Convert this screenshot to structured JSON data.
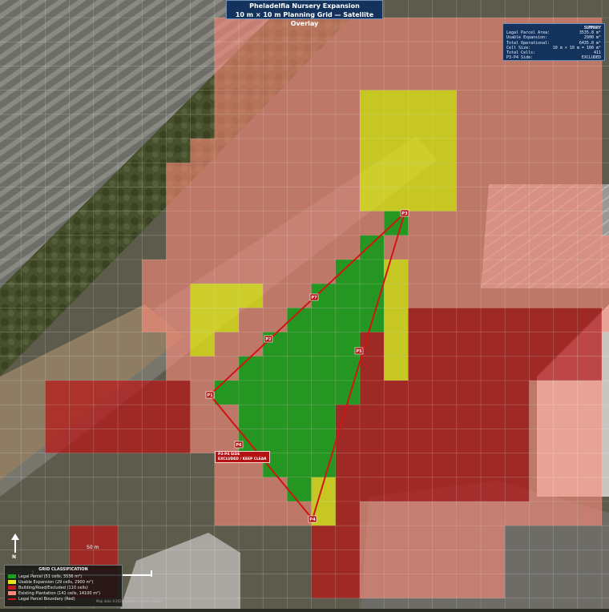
{
  "title": {
    "line1": "Pheladelfia Nursery Expansion",
    "line2": "10 m × 10 m Planning Grid — Satellite Overlay"
  },
  "summary": {
    "heading": "SUMMARY",
    "rows": [
      {
        "label": "Legal Parcel Area:",
        "value": "3535.8 m²"
      },
      {
        "label": "Usable Expansion:",
        "value": "2900 m²"
      },
      {
        "label": "Total Operational:",
        "value": "6435.8 m²"
      },
      {
        "label": "Cell Size:",
        "value": "10 m × 10 m = 100 m²"
      },
      {
        "label": "Total Cells:",
        "value": "411"
      },
      {
        "label": "P3-P4 Side:",
        "value": "EXCLUDED"
      }
    ]
  },
  "legend": {
    "heading": "GRID CLASSIFICATION",
    "items": [
      {
        "label": "Legal Parcel (51 cells, 3536 m²)",
        "color": "#1aa31a",
        "kind": "box"
      },
      {
        "label": "Usable Expansion (29 cells, 2900 m²)",
        "color": "#e5e51a",
        "kind": "box"
      },
      {
        "label": "Building/Road/Excluded (110 cells)",
        "color": "#c21a1a",
        "kind": "box"
      },
      {
        "label": "Existing Plantation (141 cells, 14100 m²)",
        "color": "#ff8a7a",
        "kind": "box"
      },
      {
        "label": "Legal Parcel Boundary (Red)",
        "color": "#d11414",
        "kind": "line"
      }
    ]
  },
  "scale_label": "50 m",
  "north_label": "N",
  "exclusion_tag": {
    "line1": "P3-P4 SIDE",
    "line2": "EXCLUDED / KEEP CLEAR"
  },
  "points": [
    {
      "id": "P1",
      "label": "P1"
    },
    {
      "id": "P2",
      "label": "P2"
    },
    {
      "id": "P3",
      "label": "P3"
    },
    {
      "id": "P4",
      "label": "P4"
    },
    {
      "id": "P5",
      "label": "P5"
    },
    {
      "id": "P6",
      "label": "P6"
    },
    {
      "id": "P7",
      "label": "P7"
    }
  ],
  "attribution": "Map data ©2024 Google  Imagery ©2024",
  "colors": {
    "legal": "#1aa31a",
    "usable": "#e5e51a",
    "excluded": "#b81616",
    "plantation": "#ff8a7a",
    "boundary": "#d11414"
  }
}
